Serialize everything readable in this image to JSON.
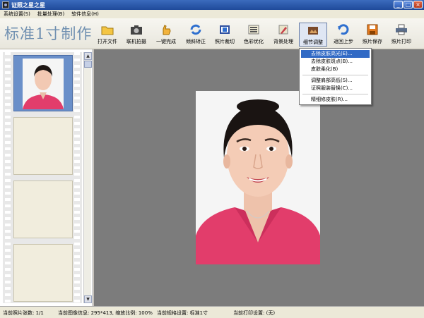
{
  "window": {
    "title": "证照之星之星"
  },
  "menu": [
    "系统设置(S)",
    "批量处理(B)",
    "软件信息(H)"
  ],
  "brand": "标准1寸制作",
  "toolbar": [
    {
      "label": "打开文件",
      "icon": "folder-icon"
    },
    {
      "label": "联机拍摄",
      "icon": "camera-icon"
    },
    {
      "label": "一键完成",
      "icon": "hand-icon"
    },
    {
      "label": "倾斜矫正",
      "icon": "rotate-icon"
    },
    {
      "label": "照片裁切",
      "icon": "crop-icon"
    },
    {
      "label": "色彩优化",
      "icon": "color-icon"
    },
    {
      "label": "背景处理",
      "icon": "brush-icon"
    },
    {
      "label": "细节调整",
      "icon": "detail-icon"
    },
    {
      "label": "返回上步",
      "icon": "undo-icon"
    },
    {
      "label": "照片保存",
      "icon": "save-icon"
    },
    {
      "label": "照片打印",
      "icon": "printer-icon"
    }
  ],
  "dropdown": [
    "去除皮肤高光(E)...",
    "去除皮肤斑点(B)...",
    "皮肤柔化(B)",
    "调整肩部高低(S)...",
    "证照服装替换(C)...",
    "精细修皮肤(R)..."
  ],
  "status": {
    "count": "当前照片张数: 1/1",
    "image_info": "当前图像信息: 295*413, 缩放比例: 100%",
    "spec": "当前规格设置: 标准1寸",
    "print": "当前打印设置: (无)"
  },
  "colors": {
    "canvas": "#7c7c7c",
    "highlight": "#316ac5",
    "brand": "#6f8fb0",
    "shirt": "#e23d6b"
  }
}
